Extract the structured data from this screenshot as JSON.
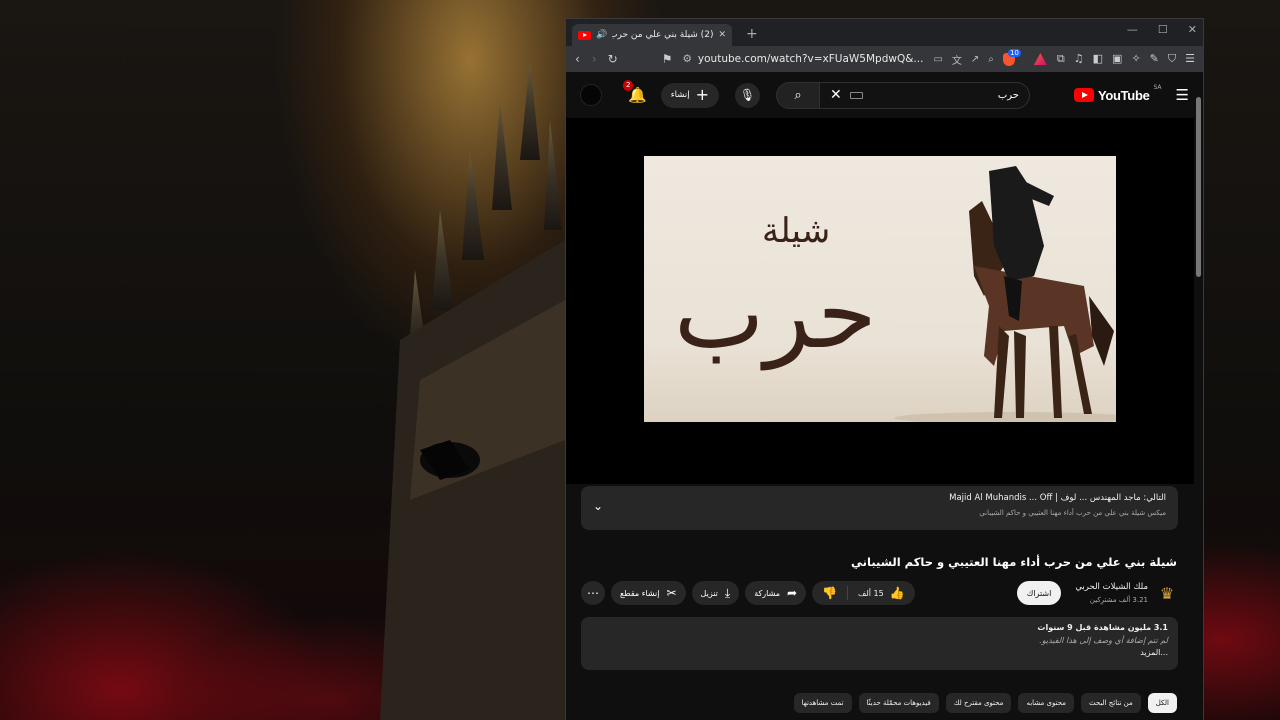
{
  "tab": {
    "title": "(2) شيلة بني علي من حرب أداء",
    "close": "✕",
    "new_tab": "+"
  },
  "window_controls": {
    "minimize": "—",
    "maximize": "☐",
    "close": "✕"
  },
  "address_bar": {
    "url": "youtube.com/watch?v=xFUaW5MpdwQ&...",
    "brave_badge": "10",
    "rewards_badge": "1"
  },
  "youtube": {
    "logo_text": "YouTube",
    "logo_region": "SA",
    "search_value": "حرب",
    "notification_count": "2",
    "create_label": "إنشاء"
  },
  "video_art": {
    "word_top": "شيلة",
    "word_main": "حرب"
  },
  "up_next": {
    "title": "التالي: ماجد المهندس ... لوف | Majid Al Muhandis ... Off",
    "subtitle": "ميكس شيلة بني علي من حرب أداء مهنا العتيبي و حاكم الشيباني"
  },
  "video": {
    "title": "شيلة بني علي من حرب أداء مهنا العتيبي و حاكم الشيباني",
    "channel_name": "ملك الشيلات الحربي",
    "channel_subs": "3.21 ألف مشترِكين",
    "subscribe_label": "اشتراك",
    "likes": "15 ألف",
    "share_label": "مشاركة",
    "download_label": "تنزيل",
    "clip_label": "إنشاء مقطع"
  },
  "description": {
    "stats_views": "3.1 مليون مشاهدة",
    "stats_age": "قبل 9 سنوات",
    "text": "لم تتم إضافة أي وصف إلى هذا الفيديو.",
    "more": "...المزيد"
  },
  "chips": [
    {
      "label": "الكل",
      "active": true
    },
    {
      "label": "من نتائج البحث",
      "active": false
    },
    {
      "label": "محتوى مشابه",
      "active": false
    },
    {
      "label": "محتوى مقترح لك",
      "active": false
    },
    {
      "label": "فيديوهات محمّلة حديثًا",
      "active": false
    },
    {
      "label": "تمت مشاهدتها",
      "active": false
    }
  ],
  "colors": {
    "yt_red": "#ff0000",
    "page_bg": "#0f0f0f",
    "chip_bg": "#272727"
  }
}
